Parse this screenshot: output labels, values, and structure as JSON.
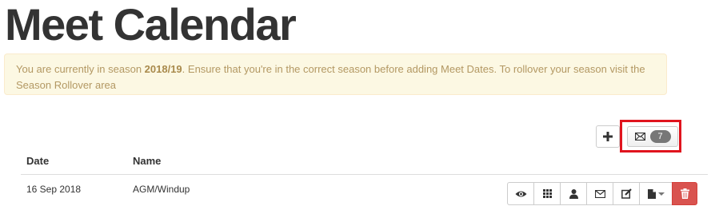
{
  "page": {
    "title": "Meet Calendar"
  },
  "alert": {
    "prefix": "You are currently in season ",
    "season": "2018/19",
    "suffix": ". Ensure that you're in the correct season before adding Meet Dates. To rollover your season visit the Season Rollover area"
  },
  "toolbar": {
    "add_icon": "plus-icon",
    "messages_icon": "envelope-icon",
    "messages_count": "7",
    "highlight_color": "#e0141e"
  },
  "table": {
    "columns": [
      "Date",
      "Name"
    ],
    "rows": [
      {
        "date": "16 Sep 2018",
        "name": "AGM/Windup",
        "actions": [
          "eye-icon",
          "grid-icon",
          "user-icon",
          "envelope-icon",
          "edit-icon",
          "file-dropdown-icon",
          "trash-icon"
        ]
      }
    ]
  },
  "colors": {
    "alert_background": "#fcf8e3",
    "alert_text": "#b39863",
    "danger": "#d9534f",
    "badge": "#777777"
  }
}
